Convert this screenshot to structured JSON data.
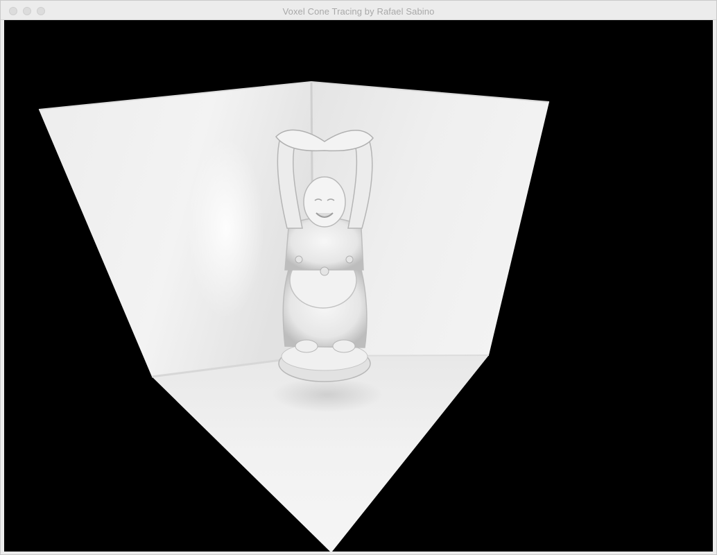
{
  "window": {
    "title": "Voxel Cone Tracing by Rafael Sabino"
  },
  "titlebar_buttons": [
    "close-button",
    "minimize-button",
    "zoom-button"
  ],
  "viewport": {
    "background_color": "#000000",
    "scene": "Buddha statue inside a white Cornell-box corner rendered with voxel cone tracing"
  }
}
